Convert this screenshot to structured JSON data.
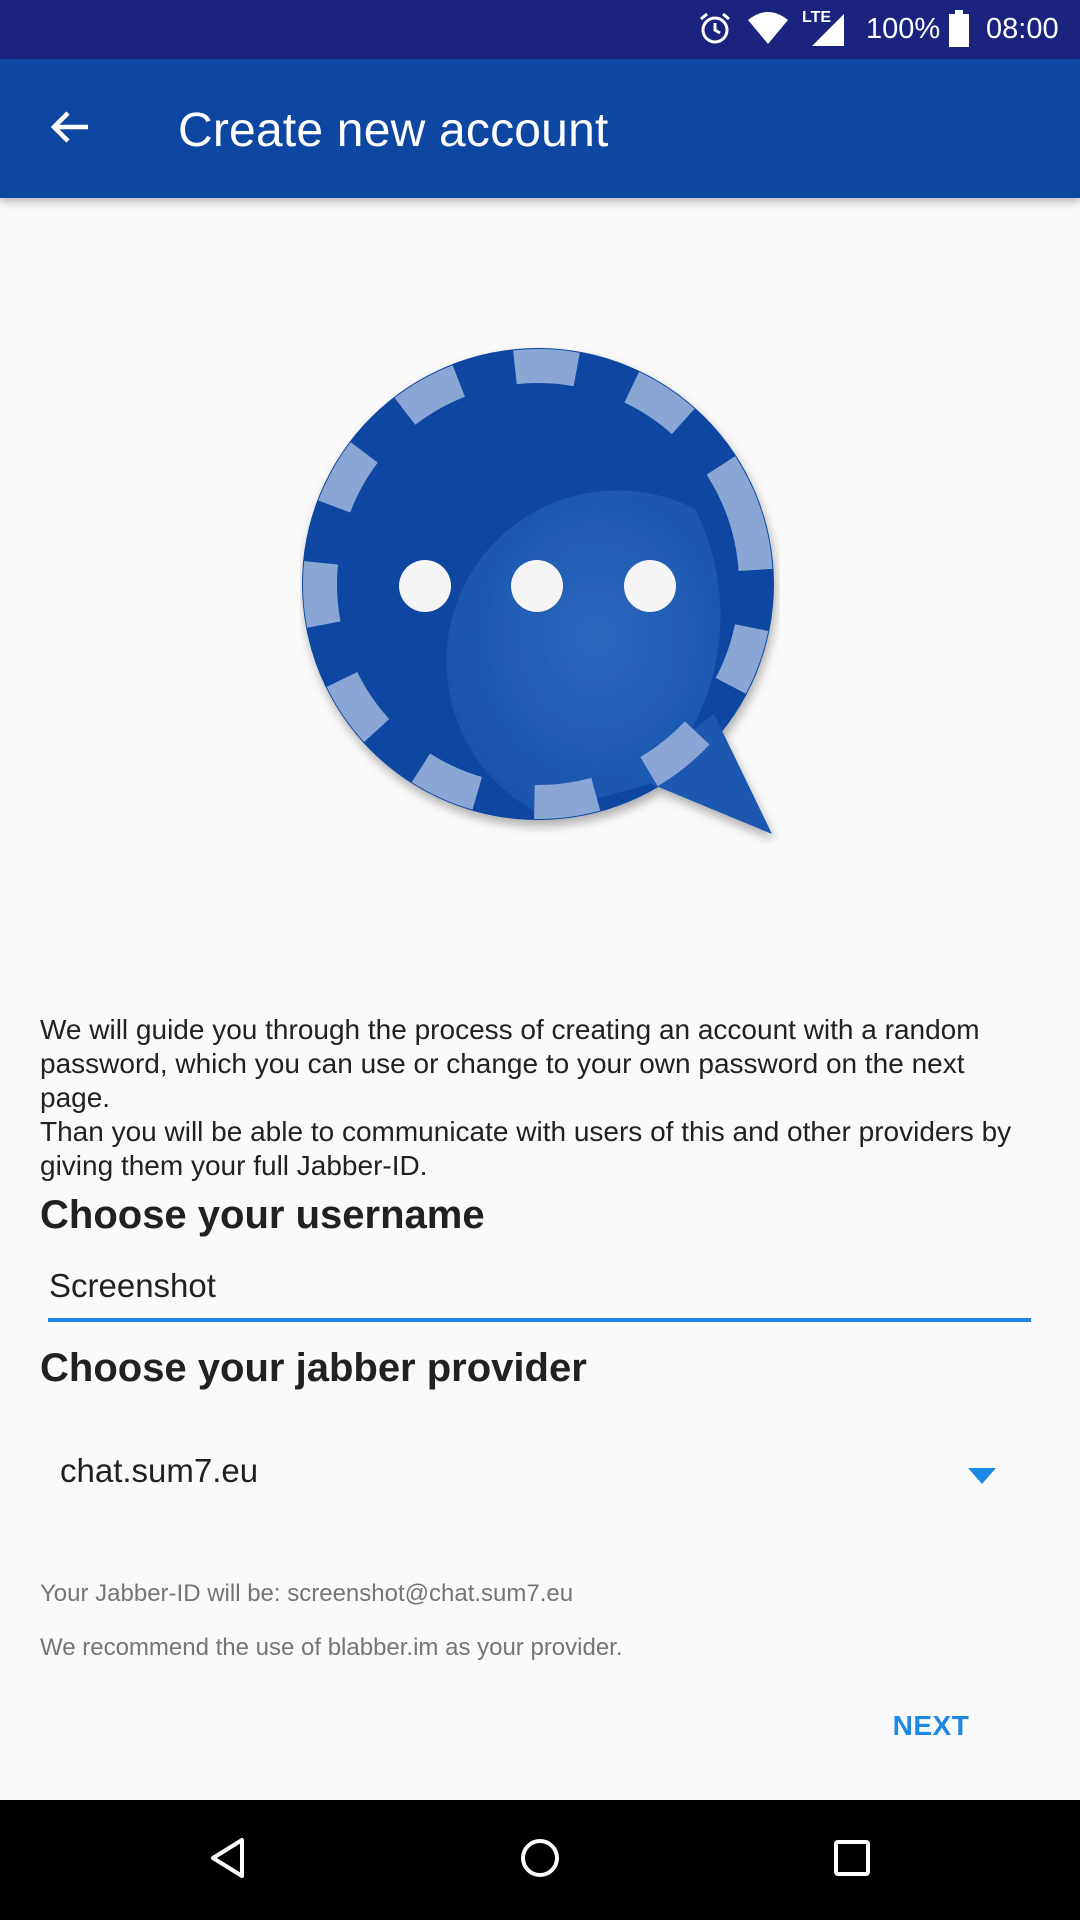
{
  "status_bar": {
    "battery_percent": "100%",
    "time": "08:00",
    "network_label": "LTE",
    "icons": [
      "alarm-icon",
      "wifi-icon",
      "signal-icon",
      "battery-icon"
    ]
  },
  "app_bar": {
    "title": "Create new account",
    "back_icon": "arrow-back-icon"
  },
  "intro": {
    "line1": "We will guide you through the process of creating an account with a random password, which you can use or change to your own password on the next page.",
    "line2": "Than you will be able to communicate with users of this and other providers by giving them your full Jabber-ID."
  },
  "username": {
    "heading": "Choose your username",
    "value": "Screenshot"
  },
  "provider": {
    "heading": "Choose your jabber provider",
    "selected": "chat.sum7.eu"
  },
  "helper": {
    "jabber_id": "Your Jabber-ID will be: screenshot@chat.sum7.eu",
    "recommend": "We recommend the use of blabber.im as your provider."
  },
  "actions": {
    "next_label": "NEXT"
  },
  "nav_bar": {
    "icons": [
      "back-triangle-icon",
      "home-circle-icon",
      "recents-square-icon"
    ]
  },
  "colors": {
    "status_bar": "#1a237e",
    "app_bar": "#0d47a1",
    "accent": "#1e88e5",
    "logo_dark": "#0d47a1",
    "logo_light": "#8aa6d4"
  }
}
